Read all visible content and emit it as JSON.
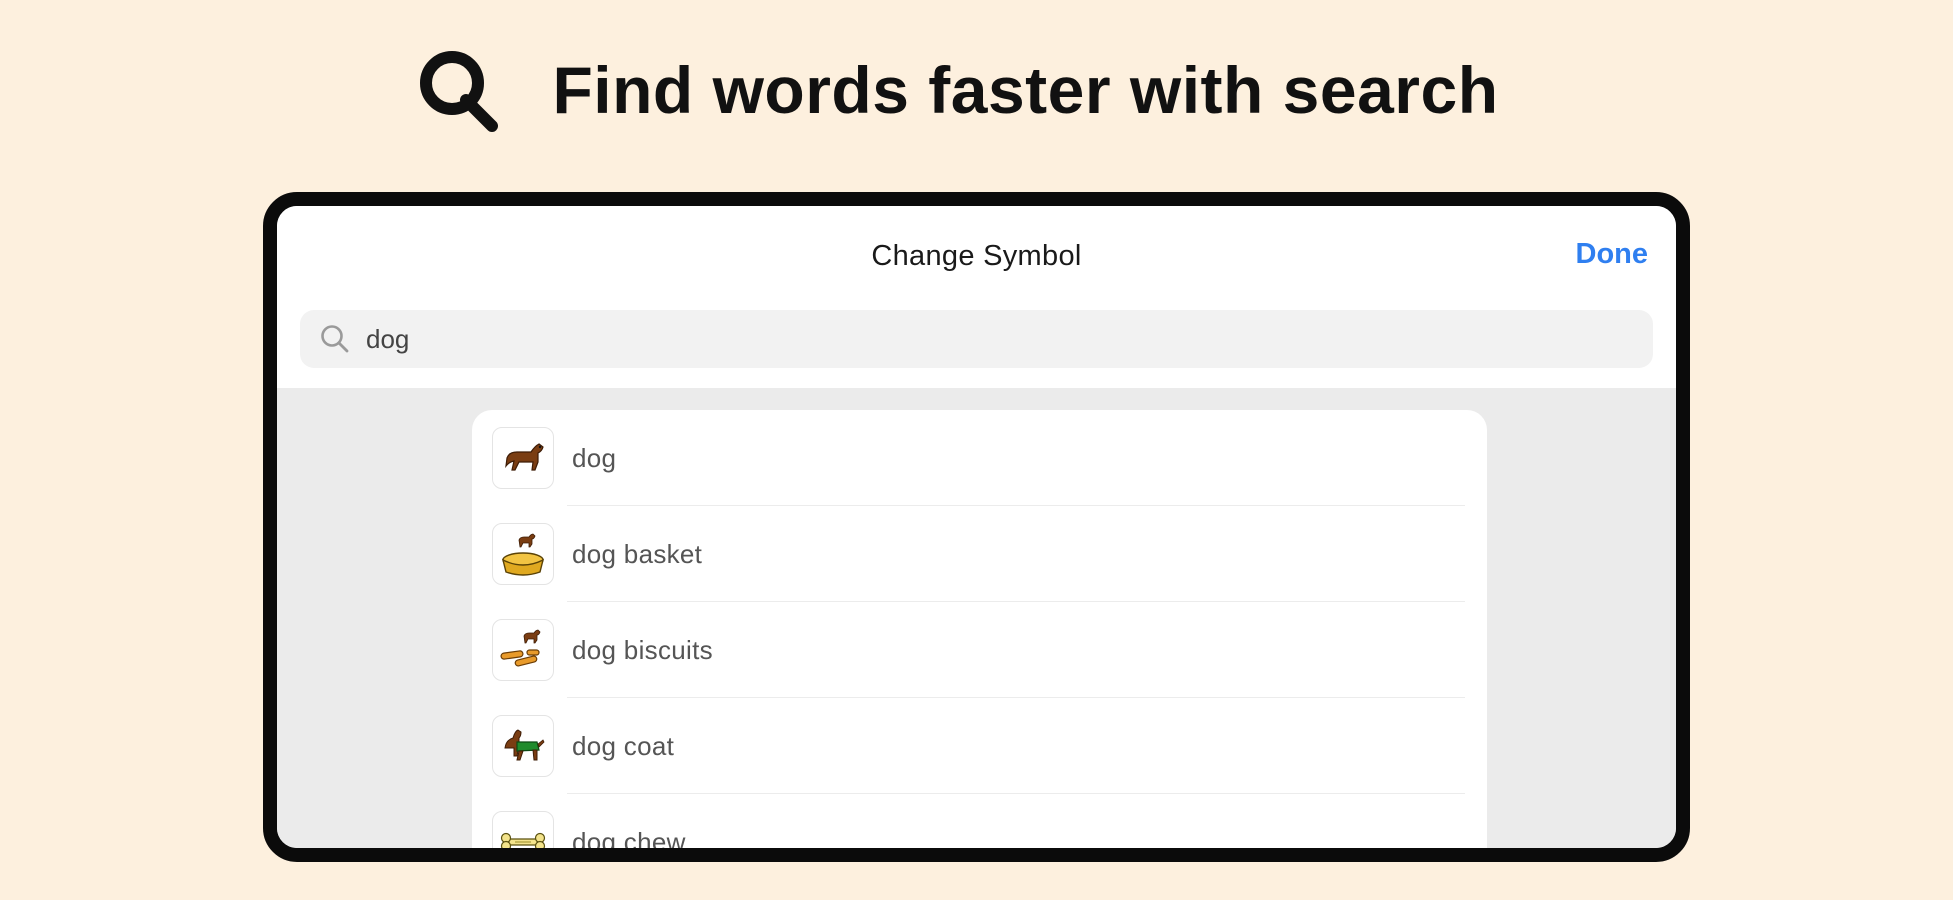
{
  "headline": {
    "icon": "search-icon",
    "text": "Find words faster with search"
  },
  "dialog": {
    "title": "Change Symbol",
    "done_label": "Done",
    "accent_color": "#2f7ff0"
  },
  "search": {
    "icon": "search-icon",
    "value": "dog"
  },
  "results": [
    {
      "label": "dog",
      "icon": "dog-icon"
    },
    {
      "label": "dog basket",
      "icon": "dog-basket-icon"
    },
    {
      "label": "dog biscuits",
      "icon": "dog-biscuits-icon"
    },
    {
      "label": "dog coat",
      "icon": "dog-coat-icon"
    },
    {
      "label": "dog chew",
      "icon": "dog-chew-icon"
    }
  ]
}
